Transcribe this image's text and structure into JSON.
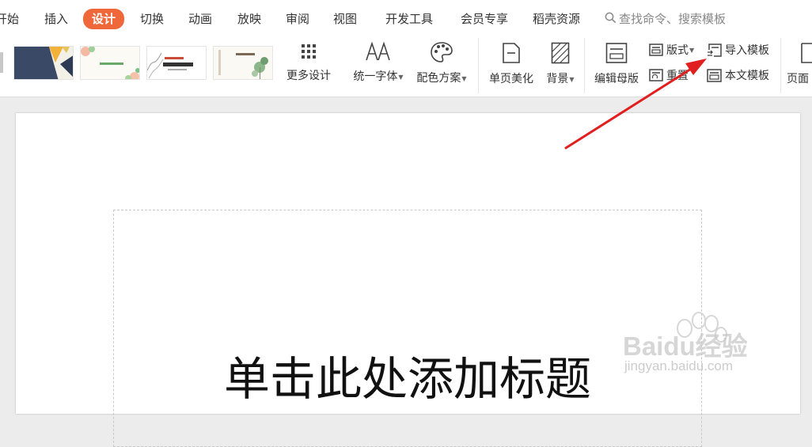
{
  "menu": {
    "items": [
      {
        "label": "开始"
      },
      {
        "label": "插入"
      },
      {
        "label": "设计"
      },
      {
        "label": "切换"
      },
      {
        "label": "动画"
      },
      {
        "label": "放映"
      },
      {
        "label": "审阅"
      },
      {
        "label": "视图"
      },
      {
        "label": "开发工具"
      },
      {
        "label": "会员专享"
      },
      {
        "label": "稻壳资源"
      }
    ],
    "active": "设计",
    "search_placeholder": "查找命令、搜索模板"
  },
  "ribbon": {
    "more_design": "更多设计",
    "unify_font": "统一字体",
    "color_scheme": "配色方案",
    "single_page_beautify": "单页美化",
    "background": "背景",
    "edit_master": "编辑母版",
    "layout": "版式",
    "reset": "重置",
    "import_template": "导入模板",
    "text_template": "本文模板",
    "page": "页面"
  },
  "slide": {
    "title_placeholder": "单击此处添加标题"
  },
  "watermark": {
    "brand": "Baidu经验",
    "url": "jingyan.baidu.com"
  },
  "colors": {
    "accent": "#f0683a",
    "arrow": "#e02020"
  }
}
